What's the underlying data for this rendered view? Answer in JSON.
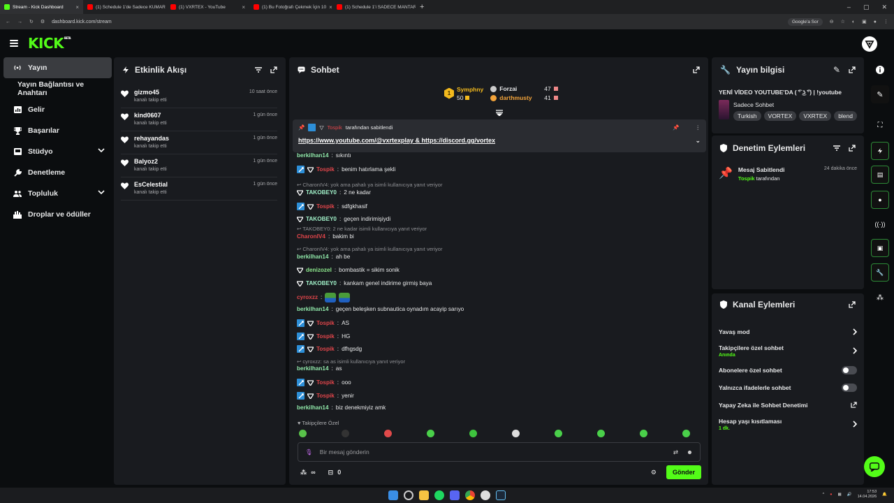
{
  "browser": {
    "tabs": [
      {
        "title": "Stream - Kick Dashboard",
        "active": true,
        "favicon_color": "#53fc18"
      },
      {
        "title": "(1) Schedule 1'de Sadece KUMAR",
        "active": false,
        "favicon_color": "#ff0000"
      },
      {
        "title": "(1) VXRTEX - YouTube",
        "active": false,
        "favicon_color": "#ff0000"
      },
      {
        "title": "(1) Bu Fotoğrafı Çekmek İçin 10",
        "active": false,
        "favicon_color": "#ff0000"
      },
      {
        "title": "(1) Schedule 1'i SADECE MANTAR",
        "active": false,
        "favicon_color": "#ff0000"
      }
    ],
    "url": "dashboard.kick.com/stream",
    "search_chip": "Google'a Sor"
  },
  "header": {
    "logo": "KICK",
    "logo_badge": "BETA"
  },
  "sidebar": {
    "items": [
      {
        "label": "Yayın",
        "icon": "broadcast-icon",
        "active": true
      },
      {
        "label": "Yayın Bağlantısı ve Anahtarı",
        "icon": "",
        "active": false
      },
      {
        "label": "Gelir",
        "icon": "bar-chart-icon",
        "active": false
      },
      {
        "label": "Başarılar",
        "icon": "trophy-icon",
        "active": false
      },
      {
        "label": "Stüdyo",
        "icon": "studio-icon",
        "active": false,
        "expandable": true
      },
      {
        "label": "Denetleme",
        "icon": "wrench-icon",
        "active": false
      },
      {
        "label": "Topluluk",
        "icon": "people-icon",
        "active": false,
        "expandable": true
      },
      {
        "label": "Droplar ve ödüller",
        "icon": "drops-icon",
        "active": false
      }
    ]
  },
  "activity": {
    "title": "Etkinlik Akışı",
    "items": [
      {
        "name": "gizmo45",
        "action": "kanalı takip etti",
        "time": "10 saat önce"
      },
      {
        "name": "kind0607",
        "action": "kanalı takip etti",
        "time": "1 gün önce"
      },
      {
        "name": "rehayandas",
        "action": "kanalı takip etti",
        "time": "1 gün önce"
      },
      {
        "name": "Balyoz2",
        "action": "kanalı takip etti",
        "time": "1 gün önce"
      },
      {
        "name": "EsCelestial",
        "action": "kanalı takip etti",
        "time": "1 gün önce"
      }
    ]
  },
  "chat": {
    "title": "Sohbet",
    "top_gifters": [
      {
        "rank": "1",
        "name": "Symphny",
        "count": "50",
        "color": "#f2b91d"
      },
      {
        "name": "Forzai",
        "count": "47",
        "color": "#e8e9ea"
      },
      {
        "name": "darthmusty",
        "count": "41",
        "color": "#f2a33a"
      }
    ],
    "pinned": {
      "by_user": "Tospik",
      "by_text": "tarafından sabitlendi",
      "link1": "https://www.youtube.com/@vxrtexplay",
      "amp": "&",
      "link2": "https://discord.gg/vortex"
    },
    "messages": [
      {
        "type": "msg",
        "user": "berkilhan14",
        "text": "sıkıntı",
        "color": "green",
        "badges": []
      },
      {
        "type": "msg",
        "user": "Tospik",
        "text": "benim hatırlama şekli",
        "color": "red",
        "badges": [
          "mod",
          "vip"
        ]
      },
      {
        "type": "reply",
        "text": "CharonIV4: yok ama pahalı ya isimli kullanıcıya yanıt veriyor"
      },
      {
        "type": "msg",
        "user": "TAKOBEY0",
        "text": "2 ne kadar",
        "color": "cyan",
        "badges": [
          "vip"
        ]
      },
      {
        "type": "msg",
        "user": "Tospik",
        "text": "sdfgkhasif",
        "color": "red",
        "badges": [
          "mod",
          "vip"
        ]
      },
      {
        "type": "msg",
        "user": "TAKOBEY0",
        "text": "geçen indirimişiydi",
        "color": "cyan",
        "badges": [
          "vip"
        ]
      },
      {
        "type": "reply",
        "text": "TAKOBEY0: 2 ne kadar isimli kullanıcıya yanıt veriyor"
      },
      {
        "type": "msg",
        "user": "CharonIV4",
        "text": "bakim bi",
        "color": "red",
        "badges": []
      },
      {
        "type": "reply",
        "text": "CharonIV4: yok ama pahalı ya isimli kullanıcıya yanıt veriyor"
      },
      {
        "type": "msg",
        "user": "berkilhan14",
        "text": "ah be",
        "color": "green",
        "badges": []
      },
      {
        "type": "msg",
        "user": "denizozel",
        "text": "bombastik = sikim sonik",
        "color": "lime",
        "badges": [
          "vip"
        ]
      },
      {
        "type": "msg",
        "user": "TAKOBEY0",
        "text": "kankam genel indirime girmiş baya",
        "color": "cyan",
        "badges": [
          "vip"
        ]
      },
      {
        "type": "msg",
        "user": "cyroxzz",
        "text": "",
        "color": "red",
        "badges": [],
        "emotes": 2
      },
      {
        "type": "msg",
        "user": "berkilhan14",
        "text": "geçen beleşken subnautica oynadım acayip sarıyo",
        "color": "green",
        "badges": []
      },
      {
        "type": "msg",
        "user": "Tospik",
        "text": "AS",
        "color": "red",
        "badges": [
          "mod",
          "vip"
        ]
      },
      {
        "type": "msg",
        "user": "Tospik",
        "text": "HG",
        "color": "red",
        "badges": [
          "mod",
          "vip"
        ]
      },
      {
        "type": "msg",
        "user": "Tospik",
        "text": "dfhgsdg",
        "color": "red",
        "badges": [
          "mod",
          "vip"
        ]
      },
      {
        "type": "reply",
        "text": "cyroxzz: sa as isimli kullanıcıya yanıt veriyor"
      },
      {
        "type": "msg",
        "user": "berkilhan14",
        "text": "as",
        "color": "green",
        "badges": []
      },
      {
        "type": "msg",
        "user": "Tospik",
        "text": "ooo",
        "color": "red",
        "badges": [
          "mod",
          "vip"
        ]
      },
      {
        "type": "msg",
        "user": "Tospik",
        "text": "yenir",
        "color": "red",
        "badges": [
          "mod",
          "vip"
        ]
      },
      {
        "type": "msg",
        "user": "berkilhan14",
        "text": "biz denekmiyiz amk",
        "color": "green",
        "badges": []
      }
    ],
    "followers_only_label": "Takipçilere Özel",
    "input_placeholder": "Bir mesaj gönderin",
    "points_label": "∞",
    "drops_count": "0",
    "send_label": "Gönder"
  },
  "stream_info": {
    "title": "Yayın bilgisi",
    "stream_title": "YENİ VİDEO YOUTUBE'DA ( ͡° ͜ʖ ͡°) | !youtube",
    "category": "Sadece Sohbet",
    "tags": [
      "Turkish",
      "VORTEX",
      "VXRTEX",
      "blend"
    ]
  },
  "mod_actions": {
    "title": "Denetim Eylemleri",
    "items": [
      {
        "action": "Mesaj Sabitlendi",
        "by_user": "Tospik",
        "by_text": "tarafından",
        "time": "24 dakika önce"
      }
    ]
  },
  "channel_actions": {
    "title": "Kanal Eylemleri",
    "items": [
      {
        "label": "Yavaş mod",
        "control": "chevron"
      },
      {
        "label": "Takipçilere özel sohbet",
        "sub": "Anında",
        "control": "chevron"
      },
      {
        "label": "Abonelere özel sohbet",
        "control": "toggle",
        "on": false
      },
      {
        "label": "Yalnızca ifadelerle sohbet",
        "control": "toggle",
        "on": false
      },
      {
        "label": "Yapay Zeka ile Sohbet Denetimi",
        "control": "external"
      },
      {
        "label": "Hesap yaşı kısıtlaması",
        "sub": "1 dk.",
        "control": "chevron"
      }
    ]
  },
  "taskbar": {
    "time": "17:53",
    "date": "14.04.2026"
  },
  "colors": {
    "accent": "#53fc18",
    "panel": "#191b1f",
    "bg": "#0b0d0f"
  }
}
